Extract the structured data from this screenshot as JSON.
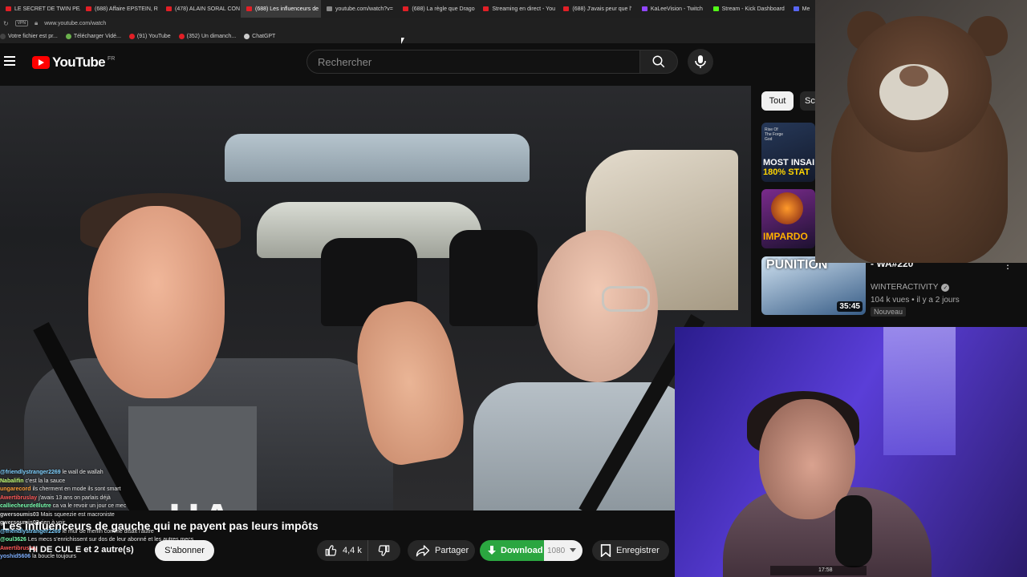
{
  "browser": {
    "tabs": [
      {
        "label": "LE SECRET DE TWIN PEA",
        "color": "#e21f26",
        "active": false
      },
      {
        "label": "(688) Affaire EPSTEIN, R",
        "color": "#e21f26",
        "active": false
      },
      {
        "label": "(478) ALAIN SORAL CON",
        "color": "#e21f26",
        "active": false
      },
      {
        "label": "(688) Les influenceurs de",
        "color": "#e21f26",
        "active": true
      },
      {
        "label": "youtube.com/watch?v=",
        "color": "#888888",
        "active": false
      },
      {
        "label": "(688) La règle que Drago",
        "color": "#e21f26",
        "active": false
      },
      {
        "label": "Streaming en direct - You",
        "color": "#e21f26",
        "active": false
      },
      {
        "label": "(688) J'avais peur que l'",
        "color": "#e21f26",
        "active": false
      },
      {
        "label": "KaLeeVision - Twitch",
        "color": "#9146ff",
        "active": false
      },
      {
        "label": "Stream - Kick Dashboard",
        "color": "#53fc18",
        "active": false
      },
      {
        "label": "Me",
        "color": "#5865f2",
        "active": false
      }
    ],
    "vpn_label": "VPN",
    "url": "www.youtube.com/watch",
    "bookmarks": [
      {
        "label": "Votre fichier est pr...",
        "color": "#444444"
      },
      {
        "label": "Télécharger Vidé...",
        "color": "#6ab04c"
      },
      {
        "label": "(91) YouTube",
        "color": "#e21f26"
      },
      {
        "label": "(352) Un dimanch...",
        "color": "#e21f26"
      },
      {
        "label": "ChatGPT",
        "color": "#cccccc"
      }
    ]
  },
  "youtube": {
    "logo_text": "YouTube",
    "region": "FR",
    "search_placeholder": "Rechercher",
    "video_title": "Les influenceurs de gauche qui ne payent pas leurs impôts",
    "channel": "HI DE CUL E et 2 autre(s)",
    "subscribe_label": "S'abonner",
    "likes": "4,4 k",
    "share_label": "Partager",
    "download_label": "Download",
    "download_quality": "1080",
    "save_label": "Enregistrer",
    "shirt_text": "HA"
  },
  "sidebar": {
    "chips": [
      "Tout",
      "Sc"
    ],
    "thumb1_text_line1": "MOST INSAI",
    "thumb1_text_line2": "180% STAT",
    "thumb1_top": "Rise Of The Forge God",
    "thumb2_text": "IMPARDO",
    "thumb3_text": "PUNITION",
    "thumb3_duration": "35:45",
    "rec_title": "Jedi_ss_...e WA#220 - WA#220",
    "rec_title_visible": "- WA#220",
    "rec_channel": "WINTERACTIVITY",
    "rec_meta": "104 k vues • il y a 2 jours",
    "rec_badge": "Nouveau"
  },
  "chat": [
    {
      "user": "@friendlystranger2269",
      "msg": "le wall de wallah",
      "color": "#7fd1ff"
    },
    {
      "user": "Nabalifin",
      "msg": "c'est la la sauce",
      "color": "#c6ff7a"
    },
    {
      "user": "ungarecord",
      "msg": "ils cherment en mode ils sont smart",
      "color": "#ff9f3a"
    },
    {
      "user": "Awertibruslay",
      "msg": "j'avais 13 ans on parlais déjà",
      "color": "#ff5a5a"
    },
    {
      "user": "calliecheurde8lutre",
      "msg": "ca va le revoir un jour ce mec",
      "color": "#7affb0"
    },
    {
      "user": "gwersoumis03",
      "msg": "Mais squeezie est macroniste",
      "color": "#cfcfcf"
    },
    {
      "user": "gwersoumis03",
      "msg": "rien à voir",
      "color": "#cfcfcf"
    },
    {
      "user": "@friendlystranger2269",
      "msg": "le mur de merlin comme disait l'autre",
      "color": "#7fd1ff"
    },
    {
      "user": "@oul3626",
      "msg": "Les mecs s'enrichissent sur dos de leur abonné et les autres mecs",
      "color": "#7affb0"
    },
    {
      "user": "Awertibruslay",
      "msg": "",
      "color": "#ff5a5a"
    },
    {
      "user": "yoshid5606",
      "msg": "la boucle toujours",
      "color": "#7fb0ff"
    }
  ],
  "overlay": {
    "time": "17:58"
  }
}
